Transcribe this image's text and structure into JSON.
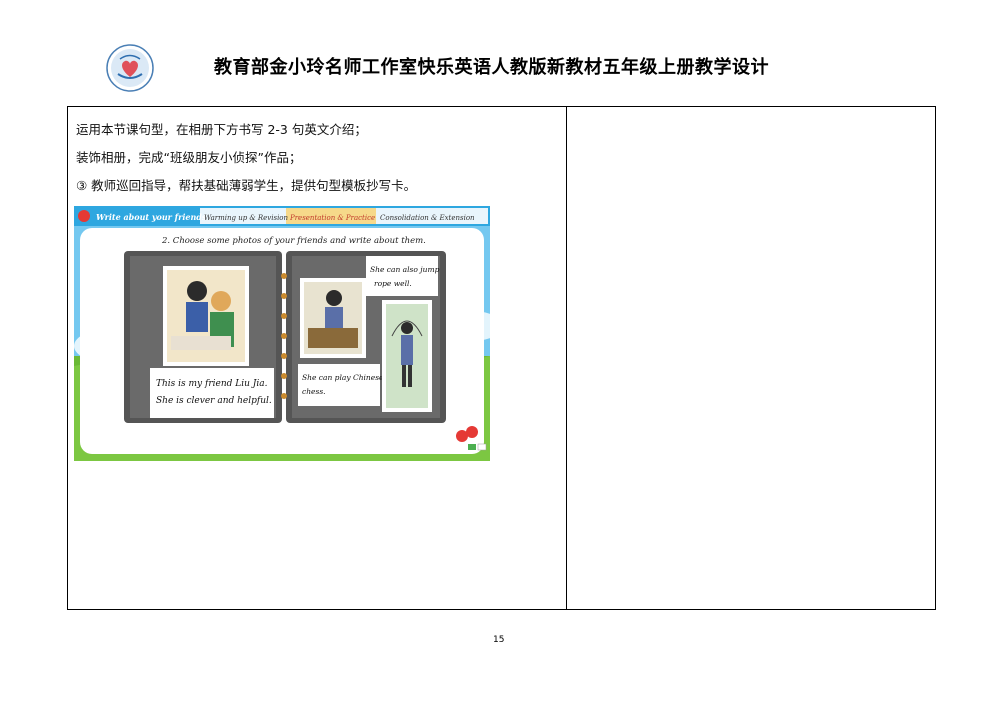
{
  "header": {
    "title": "教育部金小玲名师工作室快乐英语人教版新教材五年级上册教学设计"
  },
  "content": {
    "lines": [
      "运用本节课句型，在相册下方书写 2-3 句英文介绍；",
      "装饰相册，完成“班级朋友小侦探”作品；",
      "③ 教师巡回指导，帮扶基础薄弱学生，提供句型模板抄写卡。"
    ]
  },
  "slide": {
    "banner_title": "Write about your friends",
    "tabs": [
      "Warming up & Revision",
      "Presentation & Practice",
      "Consolidation & Extension"
    ],
    "active_tab": 1,
    "instruction": "2. Choose some photos of your friends and write about them.",
    "captions": {
      "left": [
        "This is my friend Liu Jia.",
        "She is clever and helpful."
      ],
      "middle": [
        "She can play Chinese",
        "chess."
      ],
      "right_top": [
        "She can also jump",
        "rope well."
      ]
    },
    "colors": {
      "banner": "#2ea7e0",
      "active_tab": "#f6d98a",
      "album": "#505050",
      "grass": "#6ab935"
    }
  },
  "footer": {
    "page_number": "15"
  }
}
